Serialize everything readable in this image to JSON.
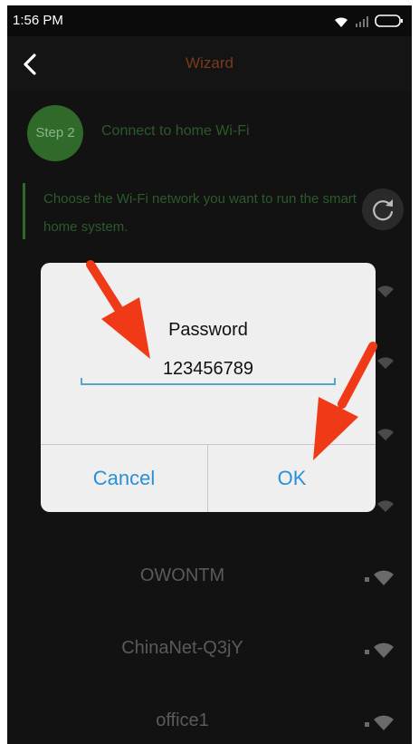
{
  "status_bar": {
    "time": "1:56 PM",
    "icons": [
      "wifi-icon",
      "cellular-icon",
      "battery-icon"
    ]
  },
  "app_bar": {
    "title": "Wizard",
    "back_icon": "chevron-left-icon"
  },
  "step": {
    "badge": "Step 2",
    "title": "Connect to home Wi-Fi"
  },
  "instruction": "Choose the Wi-Fi network you want to run the smart home system.",
  "refresh_icon": "refresh-icon",
  "networks": [
    {
      "name": "OWONTM"
    },
    {
      "name": "ChinaNet-Q3jY"
    },
    {
      "name": "office1"
    }
  ],
  "dialog": {
    "title": "Password",
    "password_value": "123456789",
    "cancel_label": "Cancel",
    "ok_label": "OK"
  },
  "colors": {
    "accent_green": "#2f6a2b",
    "dialog_button_blue": "#2b8fd6",
    "arrow_red": "#f03a17",
    "title_orange": "#7a3a1c"
  }
}
